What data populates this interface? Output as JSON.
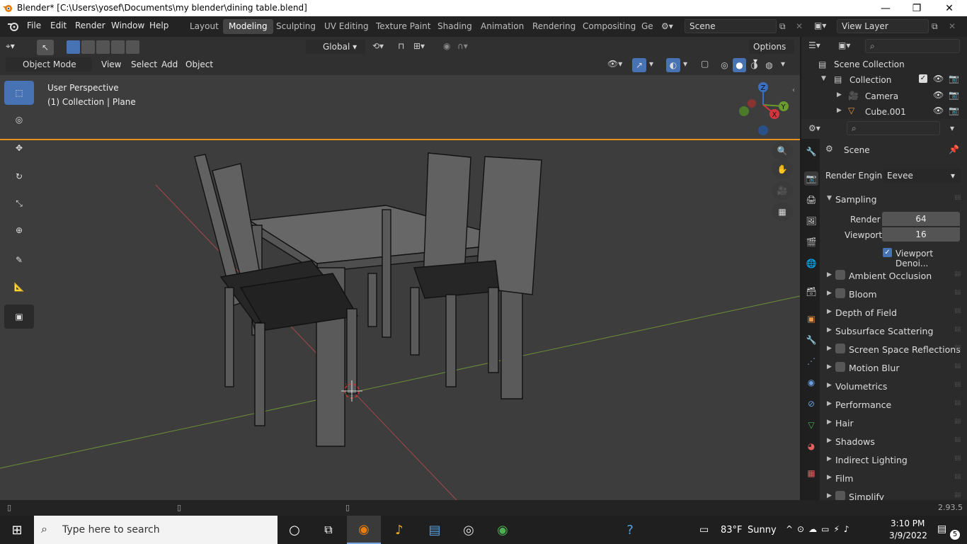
{
  "window": {
    "title": "Blender* [C:\\Users\\yosef\\Documents\\my blender\\dining table.blend]",
    "minimize": "—",
    "restore": "❐",
    "close": "✕"
  },
  "menus": [
    "File",
    "Edit",
    "Render",
    "Window",
    "Help"
  ],
  "workspaces": [
    "Layout",
    "Modeling",
    "Sculpting",
    "UV Editing",
    "Texture Paint",
    "Shading",
    "Animation",
    "Rendering",
    "Compositing",
    "Ge"
  ],
  "active_workspace": "Modeling",
  "scene_name": "Scene",
  "view_layer": "View Layer",
  "header": {
    "orientation": "Global",
    "options": "Options",
    "mode": "Object Mode",
    "view": "View",
    "select": "Select",
    "add": "Add",
    "object": "Object"
  },
  "overlay": {
    "line1": "User Perspective",
    "line2": "(1) Collection | Plane"
  },
  "axes": {
    "x": "X",
    "y": "Y",
    "z": "Z"
  },
  "outliner": {
    "root": "Scene Collection",
    "collection": "Collection",
    "items": [
      "Camera",
      "Cube.001"
    ]
  },
  "props": {
    "context": "Scene",
    "render_engine_label": "Render Engine",
    "render_engine": "Eevee",
    "sampling": "Sampling",
    "render_label": "Render",
    "render_value": "64",
    "viewport_label": "Viewport",
    "viewport_value": "16",
    "denoise": "Viewport Denoi...",
    "panels": [
      {
        "label": "Ambient Occlusion",
        "checkbox": true
      },
      {
        "label": "Bloom",
        "checkbox": true
      },
      {
        "label": "Depth of Field",
        "checkbox": false
      },
      {
        "label": "Subsurface Scattering",
        "checkbox": false
      },
      {
        "label": "Screen Space Reflections",
        "checkbox": true
      },
      {
        "label": "Motion Blur",
        "checkbox": true
      },
      {
        "label": "Volumetrics",
        "checkbox": false
      },
      {
        "label": "Performance",
        "checkbox": false
      },
      {
        "label": "Hair",
        "checkbox": false
      },
      {
        "label": "Shadows",
        "checkbox": false
      },
      {
        "label": "Indirect Lighting",
        "checkbox": false
      },
      {
        "label": "Film",
        "checkbox": false
      },
      {
        "label": "Simplify",
        "checkbox": true
      }
    ]
  },
  "status": {
    "version": "2.93.5"
  },
  "taskbar": {
    "search": "Type here to search",
    "weather_temp": "83°F",
    "weather": "Sunny",
    "time": "3:10 PM",
    "date": "3/9/2022",
    "notifications": "5"
  },
  "colors": {
    "accent": "#4772b3",
    "viewport_bg": "#3d3d3d",
    "active_outline": "#e8901c"
  }
}
